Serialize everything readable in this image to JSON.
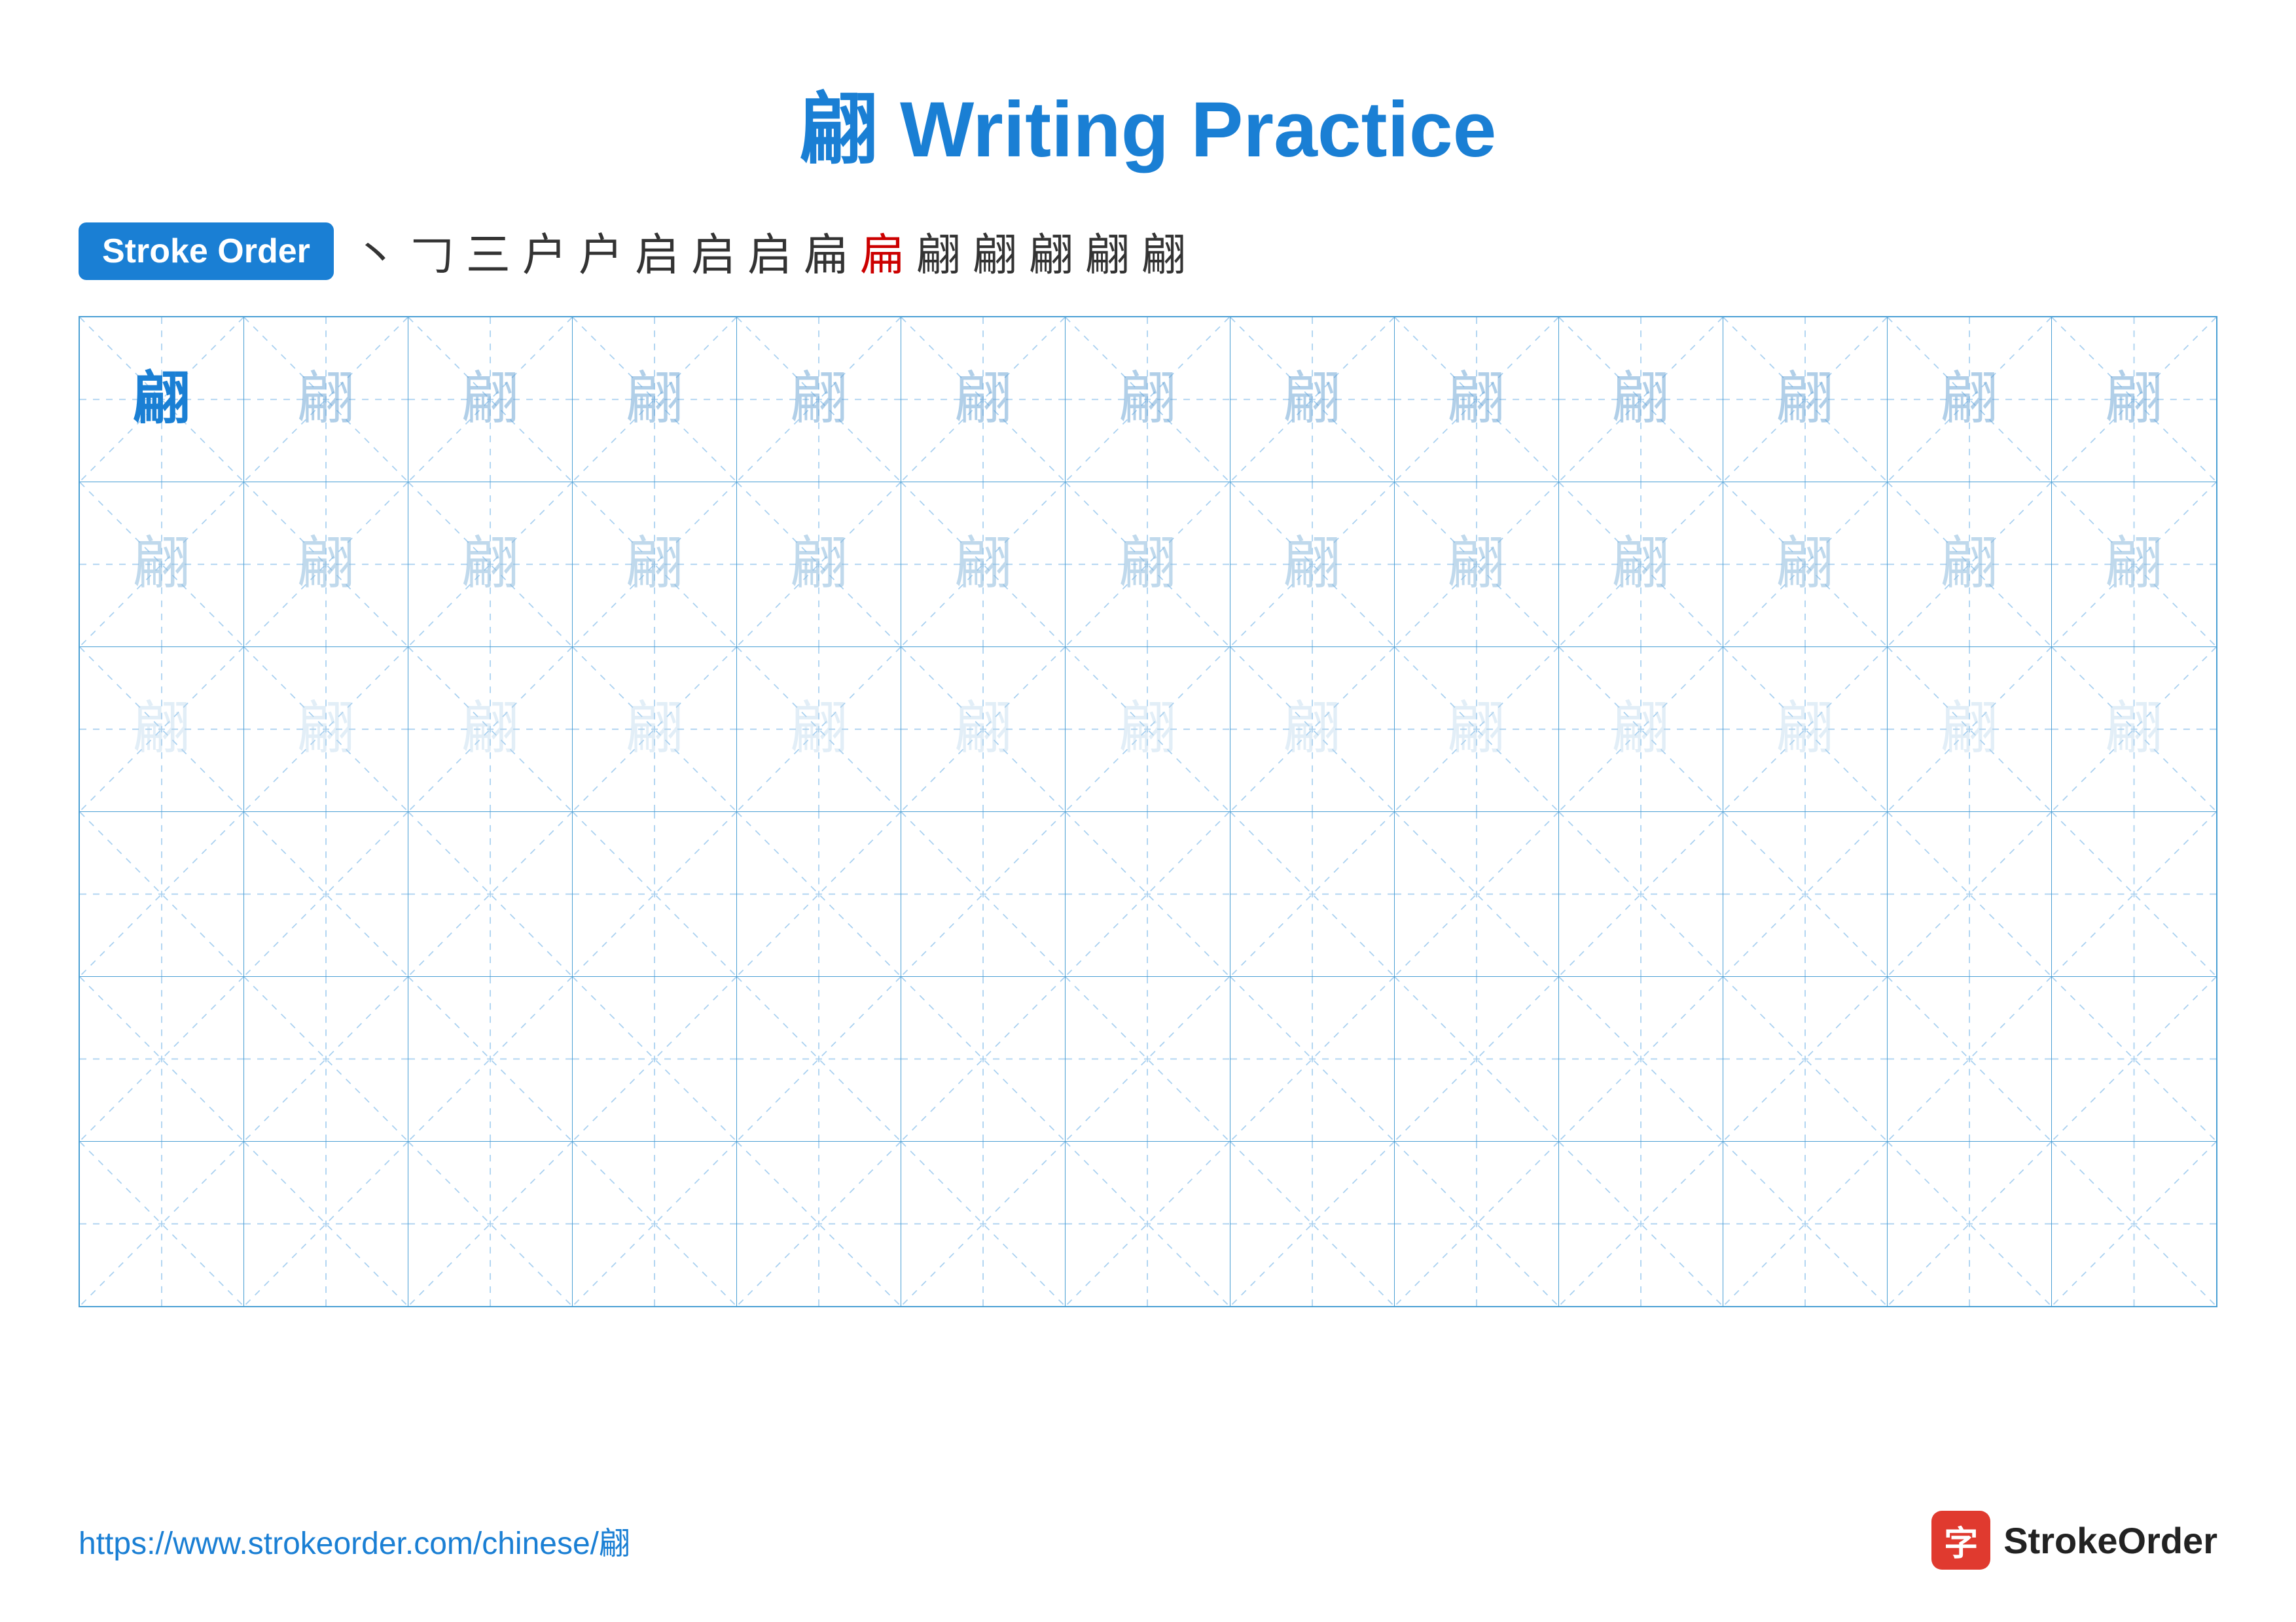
{
  "title": "翩 Writing Practice",
  "stroke_order_label": "Stroke Order",
  "stroke_sequence": [
    "丶",
    "𠃌",
    "三",
    "户",
    "户",
    "启",
    "启",
    "启",
    "扁",
    "扁",
    "翩",
    "翩",
    "翩",
    "翩",
    "翩"
  ],
  "character": "翩",
  "row1": {
    "cells": [
      {
        "char": "翩",
        "style": "dark"
      },
      {
        "char": "翩",
        "style": "medium"
      },
      {
        "char": "翩",
        "style": "medium"
      },
      {
        "char": "翩",
        "style": "medium"
      },
      {
        "char": "翩",
        "style": "medium"
      },
      {
        "char": "翩",
        "style": "medium"
      },
      {
        "char": "翩",
        "style": "medium"
      },
      {
        "char": "翩",
        "style": "medium"
      },
      {
        "char": "翩",
        "style": "medium"
      },
      {
        "char": "翩",
        "style": "medium"
      },
      {
        "char": "翩",
        "style": "medium"
      },
      {
        "char": "翩",
        "style": "medium"
      },
      {
        "char": "翩",
        "style": "medium"
      }
    ]
  },
  "row2": {
    "cells": [
      {
        "char": "翩",
        "style": "medium2"
      },
      {
        "char": "翩",
        "style": "medium2"
      },
      {
        "char": "翩",
        "style": "medium2"
      },
      {
        "char": "翩",
        "style": "medium2"
      },
      {
        "char": "翩",
        "style": "medium2"
      },
      {
        "char": "翩",
        "style": "medium2"
      },
      {
        "char": "翩",
        "style": "medium2"
      },
      {
        "char": "翩",
        "style": "medium2"
      },
      {
        "char": "翩",
        "style": "medium2"
      },
      {
        "char": "翩",
        "style": "medium2"
      },
      {
        "char": "翩",
        "style": "medium2"
      },
      {
        "char": "翩",
        "style": "medium2"
      },
      {
        "char": "翩",
        "style": "medium2"
      }
    ]
  },
  "row3": {
    "cells": [
      {
        "char": "翩",
        "style": "light"
      },
      {
        "char": "翩",
        "style": "light"
      },
      {
        "char": "翩",
        "style": "light"
      },
      {
        "char": "翩",
        "style": "light"
      },
      {
        "char": "翩",
        "style": "light"
      },
      {
        "char": "翩",
        "style": "light"
      },
      {
        "char": "翩",
        "style": "light"
      },
      {
        "char": "翩",
        "style": "light"
      },
      {
        "char": "翩",
        "style": "light"
      },
      {
        "char": "翩",
        "style": "light"
      },
      {
        "char": "翩",
        "style": "light"
      },
      {
        "char": "翩",
        "style": "light"
      },
      {
        "char": "翩",
        "style": "light"
      }
    ]
  },
  "empty_rows": 3,
  "footer": {
    "url": "https://www.strokeorder.com/chinese/翩",
    "logo_text": "StrokeOrder",
    "logo_char": "字"
  },
  "colors": {
    "blue": "#1a7fd4",
    "red": "#cc0000",
    "light_blue_border": "#4a9fd4",
    "dashed": "#a8d0f0"
  }
}
